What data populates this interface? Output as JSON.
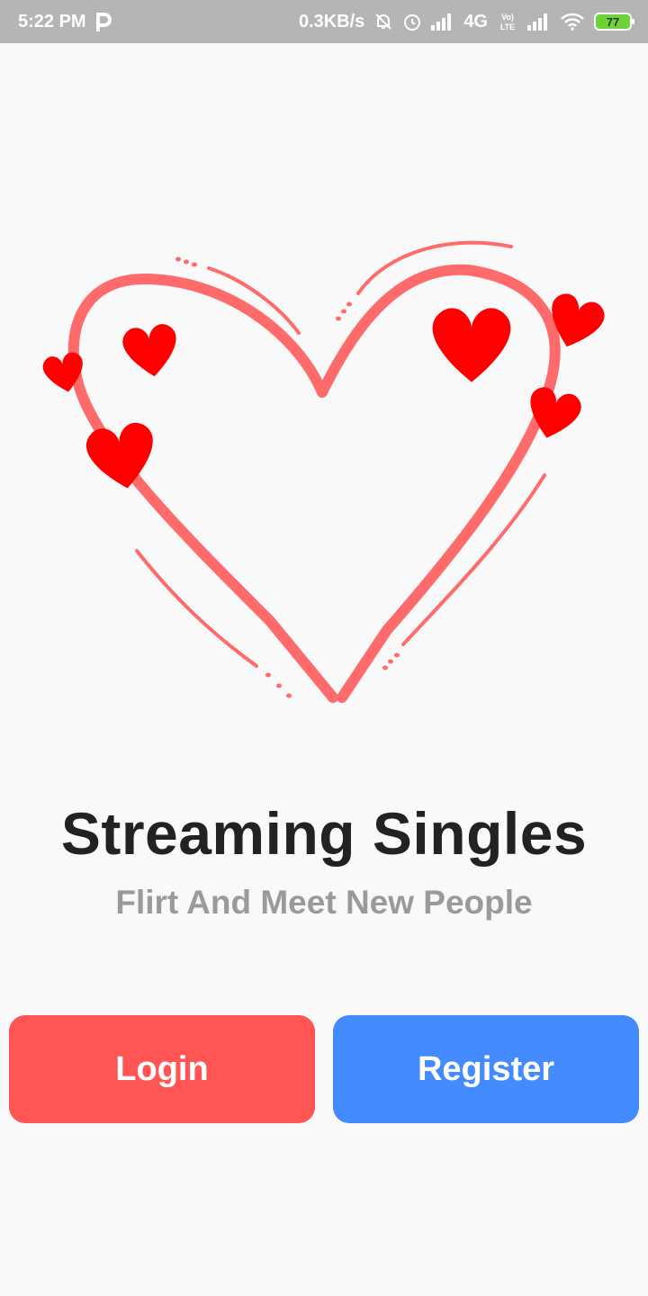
{
  "status_bar": {
    "time": "5:22 PM",
    "carrier_glyph": "P",
    "net_speed": "0.3KB/s",
    "network_type": "4G",
    "volte_label": "Vo) LTE",
    "battery": "77",
    "icons": [
      "mute-bell-icon",
      "alarm-icon",
      "signal-icon",
      "volte-icon",
      "wifi-icon",
      "battery-icon"
    ]
  },
  "hero": {
    "illustration": "heart-illustration",
    "accent": "#ff6b6b",
    "heart_color": "#ff0000"
  },
  "app": {
    "title": "Streaming Singles",
    "subtitle": "Flirt And Meet New People"
  },
  "actions": {
    "login_label": "Login",
    "register_label": "Register",
    "login_color": "#ff5555",
    "register_color": "#448bff"
  }
}
